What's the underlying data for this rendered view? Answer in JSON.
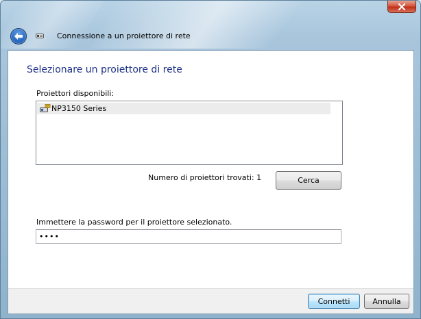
{
  "window": {
    "title": "Connessione a un proiettore di rete",
    "close_icon": "close-icon",
    "back_icon": "back-arrow-icon",
    "app_icon": "network-projector-wizard-icon"
  },
  "page": {
    "heading": "Selezionare un proiettore di rete",
    "available_label": "Proiettori disponibili:",
    "projectors": [
      {
        "name": "NP3150 Series",
        "icon": "network-projector-icon",
        "selected": true
      }
    ],
    "count_text": "Numero di proiettori trovati: 1",
    "search_button": "Cerca",
    "password_label": "Immettere la password per il proiettore selezionato.",
    "password_value": "••••"
  },
  "footer": {
    "connect_button": "Connetti",
    "cancel_button": "Annulla"
  },
  "colors": {
    "heading": "#1e3287",
    "frame": "#a8c5dc",
    "close": "#c0301a",
    "back_button": "#2a6cc4"
  }
}
